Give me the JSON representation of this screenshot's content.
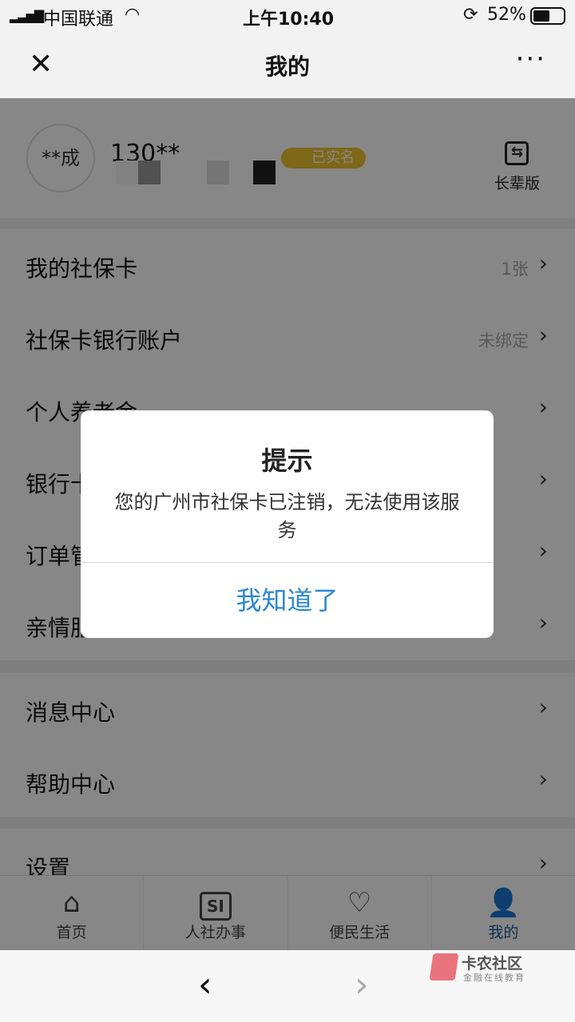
{
  "status_bar": {
    "carrier": "中国联通",
    "time": "上午10:40",
    "battery": "52%"
  },
  "navbar": {
    "title": "我的"
  },
  "profile": {
    "avatar_text": "**成",
    "phone": "130**",
    "badge": "已实名",
    "elder_mode": "长辈版"
  },
  "menu": {
    "section1": [
      {
        "label": "我的社保卡",
        "value": "1张"
      },
      {
        "label": "社保卡银行账户",
        "value": "未绑定"
      },
      {
        "label": "个人养老金",
        "value": ""
      },
      {
        "label": "银行卡",
        "value": ""
      },
      {
        "label": "订单管理",
        "value": ""
      },
      {
        "label": "亲情服务",
        "value": ""
      }
    ],
    "section2": [
      {
        "label": "消息中心"
      },
      {
        "label": "帮助中心"
      }
    ],
    "section3": [
      {
        "label": "设置"
      }
    ]
  },
  "tabbar": [
    {
      "label": "首页",
      "icon": "home-icon"
    },
    {
      "label": "人社办事",
      "icon": "si-icon"
    },
    {
      "label": "便民生活",
      "icon": "heart-handshake-icon"
    },
    {
      "label": "我的",
      "icon": "user-icon",
      "active": true
    }
  ],
  "dialog": {
    "title": "提示",
    "message": "您的广州市社保卡已注销，无法使用该服务",
    "confirm": "我知道了"
  },
  "watermark": {
    "name": "卡农社区",
    "sub": "金融在线教育"
  },
  "colors": {
    "accent": "#2a87d4",
    "active_tab": "#1a5a9c",
    "badge": "#f0c22e"
  }
}
